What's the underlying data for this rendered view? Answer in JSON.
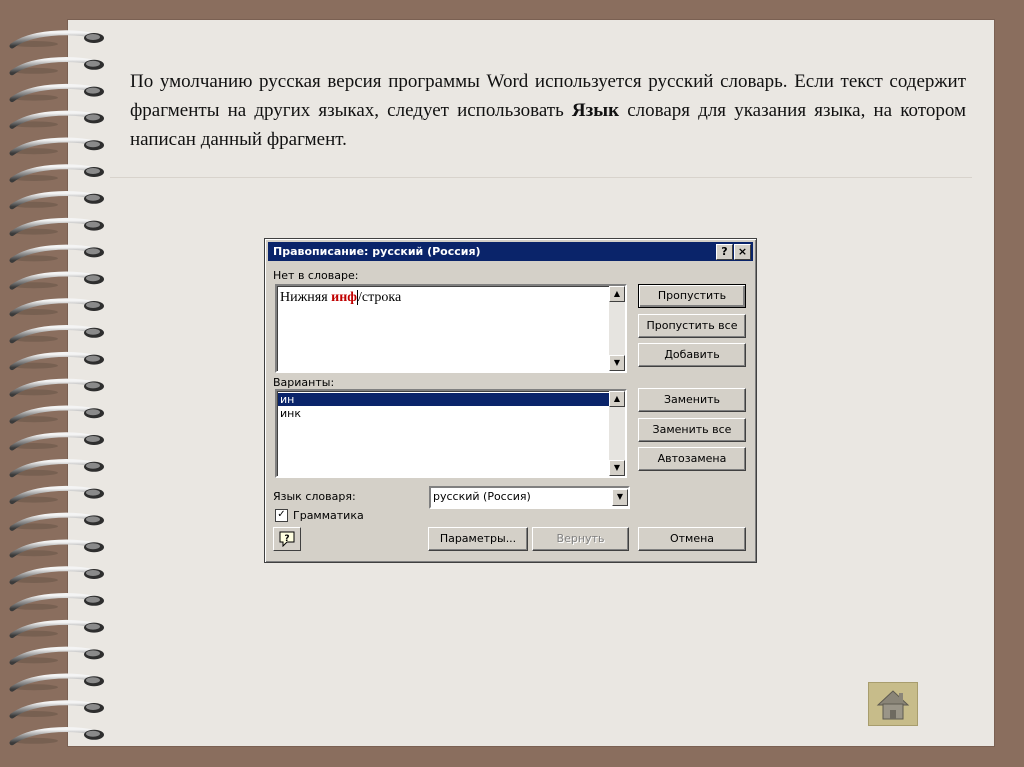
{
  "intro": {
    "part1": "По умолчанию русская версия программы Word используется русский словарь. Если текст содержит фрагменты на других языках, следует использовать ",
    "bold": "Язык",
    "part2": " словаря для указания языка, на котором написан данный фрагмент."
  },
  "dialog": {
    "title": "Правописание: русский (Россия)",
    "help_glyph": "?",
    "close_glyph": "×",
    "not_in_dict_label": "Нет в словаре:",
    "sentence": {
      "before": "Нижняя ",
      "error": "инф",
      "after": "/строка"
    },
    "suggestions_label": "Варианты:",
    "suggestions": [
      "ин",
      "инк"
    ],
    "selected_suggestion_index": 0,
    "lang_label": "Язык словаря:",
    "lang_value": "русский (Россия)",
    "grammar_label": "Грамматика",
    "grammar_checked": true,
    "buttons": {
      "skip": "Пропустить",
      "skip_all": "Пропустить все",
      "add": "Добавить",
      "replace": "Заменить",
      "replace_all": "Заменить все",
      "autocorrect": "Автозамена",
      "options": "Параметры...",
      "undo": "Вернуть",
      "cancel": "Отмена"
    }
  },
  "colors": {
    "frame": "#8a6e5e",
    "page": "#eae7e2",
    "titlebar": "#0a246a",
    "dialog_face": "#d4d0c8",
    "error_text": "#c00000",
    "home_button": "#c7bc8a"
  },
  "icons": [
    "spiral-binding",
    "question-icon",
    "close-icon",
    "scroll-up-icon",
    "scroll-down-icon",
    "dropdown-arrow-icon",
    "home-icon"
  ]
}
